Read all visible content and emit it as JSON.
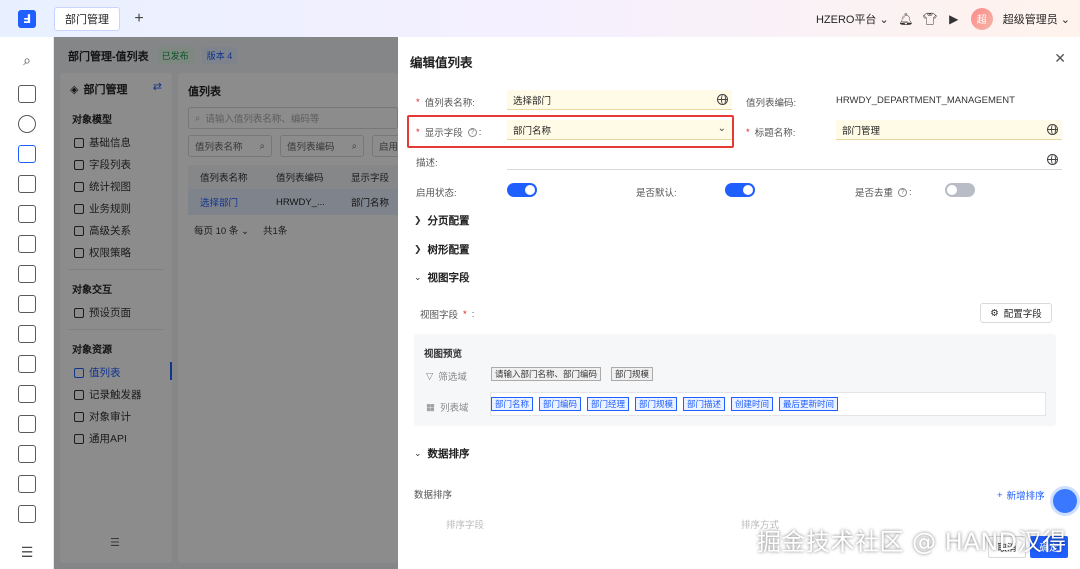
{
  "topbar": {
    "tab_label": "部门管理",
    "tab_add": "+",
    "platform": "HZERO平台 ⌄",
    "user_avatar": "超",
    "user_name": "超级管理员 ⌄"
  },
  "page": {
    "title": "部门管理-值列表",
    "status_badge": "已发布",
    "version_badge": "版本 4",
    "side": {
      "title": "部门管理",
      "group_model": "对象模型",
      "model_items": [
        "基础信息",
        "字段列表",
        "统计视图",
        "业务规则",
        "高级关系",
        "权限策略"
      ],
      "group_interact": "对象交互",
      "interact_items": [
        "预设页面"
      ],
      "group_resource": "对象资源",
      "resource_items": [
        "值列表",
        "记录触发器",
        "对象审计",
        "通用API"
      ]
    },
    "main": {
      "title": "值列表",
      "search_placeholder": "请输入值列表名称、编码等",
      "filter_name": "值列表名称",
      "filter_code": "值列表编码",
      "filter_more": "启用",
      "columns": [
        "值列表名称",
        "值列表编码",
        "显示字段"
      ],
      "row": [
        "选择部门",
        "HRWDY_...",
        "部门名称"
      ],
      "page_size": "每页 10 条",
      "total": "共1条"
    }
  },
  "drawer": {
    "title": "编辑值列表",
    "fields": {
      "name_label": "值列表名称:",
      "name_value": "选择部门",
      "code_label": "值列表编码:",
      "code_value": "HRWDY_DEPARTMENT_MANAGEMENT",
      "display_label": "显示字段",
      "display_value": "部门名称",
      "title_label": "标题名称:",
      "title_value": "部门管理",
      "desc_label": "描述:",
      "enable_label": "启用状态:",
      "default_label": "是否默认:",
      "dedupe_label": "是否去重"
    },
    "sections": [
      "分页配置",
      "树形配置",
      "视图字段",
      "数据排序"
    ],
    "view_fields_label": "视图字段",
    "config_button": "配置字段",
    "preview": {
      "title": "视图预览",
      "filter_label": "筛选域",
      "list_label": "列表域",
      "filter_chips": [
        "请输入部门名称、部门编码",
        "部门规模"
      ],
      "list_chips": [
        "部门名称",
        "部门编码",
        "部门经理",
        "部门规模",
        "部门描述",
        "创建时间",
        "最后更新时间"
      ]
    },
    "sort_label": "数据排序",
    "add_sort": "新增排序",
    "sort_col_a": "排序字段",
    "sort_col_b": "排序方式",
    "cancel": "取消",
    "ok": "确定"
  },
  "switches": {
    "enable": true,
    "default": true,
    "dedupe": false
  },
  "watermark": "掘金技术社区 @ HAND汉得"
}
